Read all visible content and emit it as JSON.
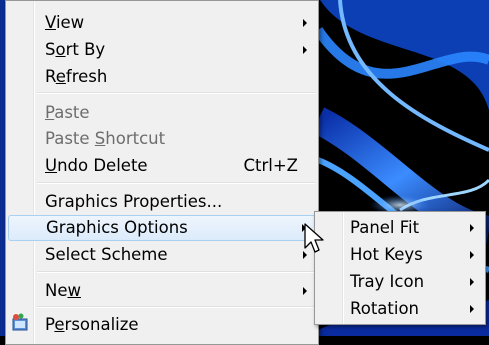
{
  "context_menu": {
    "items": [
      {
        "pre": "",
        "u": "V",
        "post": "iew",
        "submenu": true
      },
      {
        "pre": "S",
        "u": "o",
        "post": "rt By",
        "submenu": true
      },
      {
        "pre": "R",
        "u": "e",
        "post": "fresh"
      },
      {
        "pre": "",
        "u": "P",
        "post": "aste",
        "disabled": true
      },
      {
        "pre": "Paste ",
        "u": "S",
        "post": "hortcut",
        "disabled": true
      },
      {
        "pre": "",
        "u": "U",
        "post": "ndo Delete",
        "shortcut": "Ctrl+Z"
      },
      {
        "pre": "Graphics Properties...",
        "u": "",
        "post": ""
      },
      {
        "pre": "Graphics Options",
        "u": "",
        "post": "",
        "submenu": true,
        "highlighted": true
      },
      {
        "pre": "Select Scheme",
        "u": "",
        "post": "",
        "submenu": true
      },
      {
        "pre": "Ne",
        "u": "w",
        "post": "",
        "submenu": true
      },
      {
        "pre": "P",
        "u": "e",
        "post": "rsonalize"
      }
    ]
  },
  "graphics_submenu": {
    "items": [
      {
        "label": "Panel Fit"
      },
      {
        "label": "Hot Keys"
      },
      {
        "label": "Tray Icon"
      },
      {
        "label": "Rotation"
      }
    ]
  },
  "colors": {
    "menu_bg": "#f0f0f0",
    "highlight_border": "#a8d0f0",
    "disabled_text": "#6d6d6d",
    "wallpaper_bg": "#000000",
    "wallpaper_swirl": "#1e6ff0"
  }
}
